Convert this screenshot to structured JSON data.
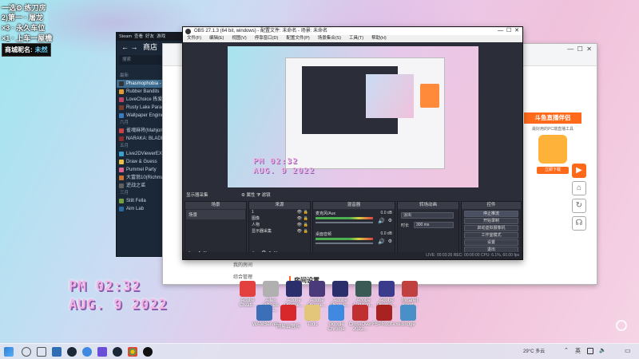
{
  "overlay": {
    "line1": "一选⚙ 练刀房",
    "line2": "2)第一 · 屠龙",
    "line3": "×3 · 永久车位",
    "line4": "×1 · 上车一屋檐",
    "name_label": "商城昵名:",
    "name_value": "未然"
  },
  "desktop_clock": {
    "time": "PM 02:32",
    "date": "AUG. 9 2022"
  },
  "desktop_icons": [
    {
      "label": "Adobe Creati...",
      "color": "#e34040"
    },
    {
      "label": "Allen Wheels Crea...",
      "color": "#b0b0b0"
    },
    {
      "label": "Adobe Premie...",
      "color": "#2a2f6b"
    },
    {
      "label": "Adobe Premie...",
      "color": "#4a3a7a"
    },
    {
      "label": "Adobe Premie...",
      "color": "#2a2f6b"
    },
    {
      "label": "Adobe Audition...",
      "color": "#3a5a55"
    },
    {
      "label": "Adobe Premie...",
      "color": "#3b3b8b"
    },
    {
      "label": "Intranet Sport...",
      "color": "#c04040"
    }
  ],
  "desktop_icons_row2": [
    {
      "label": "WAMServer",
      "color": "#3b6fb8"
    },
    {
      "label": "网易云音乐",
      "color": "#d8282b"
    },
    {
      "label": "Todo",
      "color": "#e3c67a"
    },
    {
      "label": "Google Chrome",
      "color": "#3f8ae0"
    },
    {
      "label": "CrossOver 2022...",
      "color": "#c03030"
    },
    {
      "label": "FSPRoof.exe",
      "color": "#a82222"
    },
    {
      "label": "Bridge",
      "color": "#4a90c8"
    }
  ],
  "steam": {
    "title": "Steam",
    "menu": [
      "Steam",
      "查看",
      "好友",
      "游戏"
    ],
    "nav_label": "商店",
    "search": "搜索",
    "section_recent": "最新",
    "games_recent": [
      {
        "name": "Phasmophobia - ",
        "color": "#333",
        "selected": true
      },
      {
        "name": "Rubber Bandits",
        "color": "#e39a2e"
      },
      {
        "name": "LoveChoice 拣爱",
        "color": "#c04060"
      },
      {
        "name": "Rusty Lake Paradi",
        "color": "#7a3a2a"
      },
      {
        "name": "Wallpaper Engine",
        "color": "#3a7ac0"
      }
    ],
    "section_2": "六月",
    "games_2": [
      {
        "name": "雀魂麻将(Mahjong",
        "color": "#d04040"
      },
      {
        "name": "NARAKA: BLADEP",
        "color": "#8a2a2a"
      }
    ],
    "section_3": "五月",
    "games_3": [
      {
        "name": "Live2DViewerEX",
        "color": "#3aa0d0"
      },
      {
        "name": "Draw & Guess",
        "color": "#f0c040"
      },
      {
        "name": "Pummel Party",
        "color": "#e06090"
      },
      {
        "name": "大富翁10(Richma",
        "color": "#d07030"
      },
      {
        "name": "逆战之谣",
        "color": "#606060"
      }
    ],
    "section_4": "三月",
    "games_4": [
      {
        "name": "Stilt Fella",
        "color": "#70a040"
      },
      {
        "name": "Aim Lab",
        "color": "#2a6aa0"
      }
    ]
  },
  "browser": {
    "promo_title": "斗鱼直播伴侣",
    "promo_sub": "最好用的PC端直播工具",
    "promo_btn": "立即下载",
    "side_items": [
      "我的房间",
      "综合管理"
    ],
    "section_title": "房间设置"
  },
  "obs": {
    "title": "OBS 27.1.3 (64 bit, windows) - 配置文件: 未命名 - 场景: 未命名",
    "menu": [
      "文件(F)",
      "编辑(E)",
      "视图(V)",
      "停靠窗口(D)",
      "配置文件(P)",
      "场景集合(S)",
      "工具(T)",
      "帮助(H)"
    ],
    "preview_source": "显示器采集",
    "toolbar": [
      "属性",
      "滤镜"
    ],
    "docks": {
      "scenes": {
        "title": "场景",
        "items": [
          "场景"
        ]
      },
      "sources": {
        "title": "来源",
        "items": [
          "1",
          "图像",
          "人物",
          "显示器采集"
        ]
      },
      "mixer": {
        "title": "混音器",
        "channels": [
          {
            "name": "桌面音频",
            "db": "0.0 dB"
          },
          {
            "name": "麦克风/Aux",
            "db": "0.0 dB"
          }
        ]
      },
      "transitions": {
        "title": "转场动画",
        "type": "淡出",
        "duration_label": "时长",
        "duration": "300 ms"
      },
      "controls": {
        "title": "控件",
        "buttons": [
          "停止推流",
          "开始录制",
          "启动虚拟摄像机",
          "工作室模式",
          "设置",
          "退出"
        ]
      }
    },
    "status": "LIVE: 00:03:26   REC: 00:00:00   CPU: 6.1%, 60.00 fps"
  },
  "taskbar": {
    "weather": "29°C 多云",
    "tray": "英"
  }
}
